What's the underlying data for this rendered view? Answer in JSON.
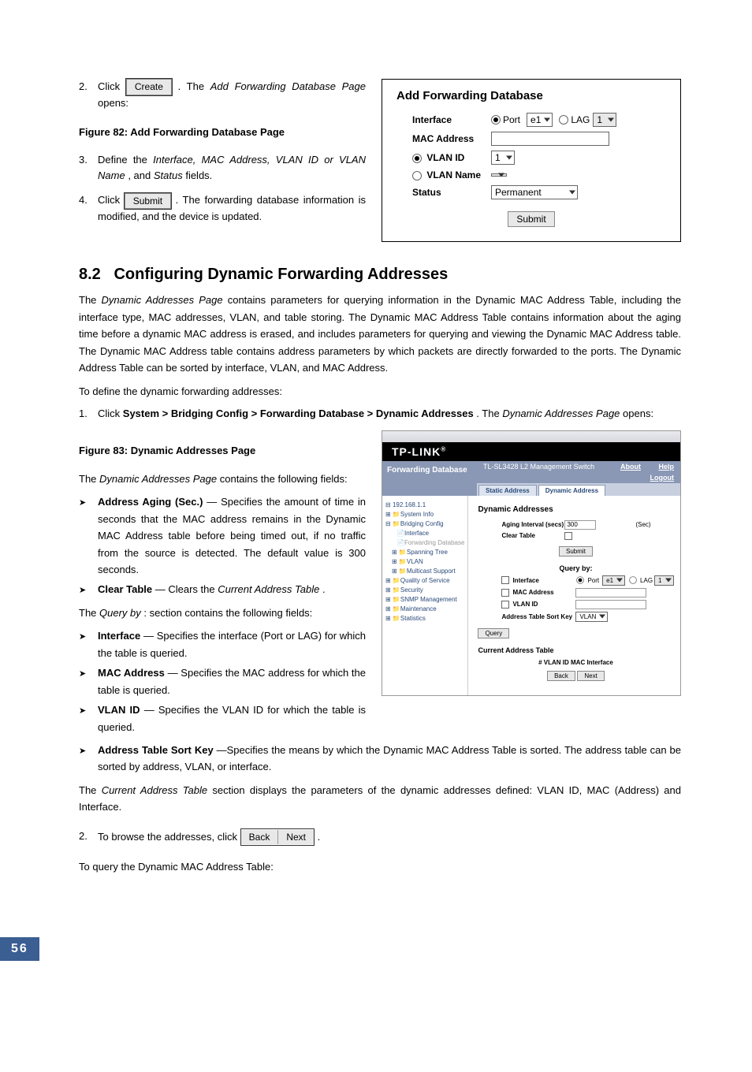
{
  "steps_top": {
    "s2_num": "2.",
    "s2_a": "Click ",
    "s2_btn": "Create",
    "s2_b": ". The ",
    "s2_c": "Add Forwarding Database Page",
    "s2_d": " opens:",
    "s3_num": "3.",
    "s3_a": "Define the ",
    "s3_b": "Interface, MAC Address, VLAN ID or VLAN Name",
    "s3_c": ", and ",
    "s3_d": "Status",
    "s3_e": " fields.",
    "s4_num": "4.",
    "s4_a": "Click ",
    "s4_btn": "Submit",
    "s4_b": ". The forwarding database information is modified, and the device is updated."
  },
  "fig82_caption": "Figure 82: Add Forwarding Database Page",
  "afd": {
    "title": "Add Forwarding Database",
    "interface": "Interface",
    "port": "Port",
    "port_val": "e1",
    "lag": "LAG",
    "lag_val": "1",
    "mac": "MAC Address",
    "vlanid": "VLAN ID",
    "vlanid_val": "1",
    "vlanname": "VLAN Name",
    "status": "Status",
    "status_val": "Permanent",
    "submit": "Submit"
  },
  "section_num": "8.2",
  "section_title": "Configuring Dynamic Forwarding Addresses",
  "para1_a": "The ",
  "para1_b": "Dynamic Addresses Page",
  "para1_c": " contains parameters for querying information in the Dynamic MAC Address Table, including the interface type, MAC addresses, VLAN, and table storing. The Dynamic MAC Address Table contains information about the aging time before a dynamic MAC address is erased, and includes parameters for querying and viewing the Dynamic MAC Address table. The Dynamic MAC Address table contains address parameters by which packets are directly forwarded to the ports. The Dynamic Address Table can be sorted by interface, VLAN, and MAC Address.",
  "para2": "To define the dynamic forwarding addresses:",
  "step1_num": "1.",
  "step1_a": "Click ",
  "step1_b": "System > Bridging Config > Forwarding Database > Dynamic Addresses",
  "step1_c": ". The ",
  "step1_d": "Dynamic Addresses Page",
  "step1_e": " opens:",
  "fig83_caption": "Figure 83: Dynamic Addresses Page",
  "para3_a": "The ",
  "para3_b": "Dynamic Addresses Page",
  "para3_c": " contains the following fields:",
  "bullets1": {
    "b1_a": "Address Aging (Sec.)",
    "b1_b": " — Specifies the amount of time in seconds that the MAC address remains in the Dynamic MAC Address table before being timed out, if no traffic from the source is detected. The default value is 300 seconds.",
    "b2_a": "Clear Table",
    "b2_b": " — Clears the ",
    "b2_c": "Current Address Table",
    "b2_d": "."
  },
  "para4_a": "The ",
  "para4_b": "Query by",
  "para4_c": ": section contains the following fields:",
  "bullets2": {
    "b1_a": "Interface",
    "b1_b": " — Specifies the interface (Port or LAG) for which the table is queried.",
    "b2_a": "MAC Address",
    "b2_b": " — Specifies the MAC address for which the table is queried.",
    "b3_a": "VLAN ID",
    "b3_b": " — Specifies the VLAN ID for which the table is queried.",
    "b4_a": "Address Table Sort Key",
    "b4_b": " —Specifies the means by which the Dynamic MAC Address Table is sorted. The address table can be sorted by address, VLAN, or interface."
  },
  "para5_a": "The ",
  "para5_b": "Current Address Table",
  "para5_c": " section displays the parameters of the dynamic addresses defined: VLAN ID, MAC (Address) and Interface.",
  "step2_num": "2.",
  "step2_a": "To browse the addresses, click ",
  "step2_back": "Back",
  "step2_next": "Next",
  "step2_b": ".",
  "para6": "To query the Dynamic MAC Address Table:",
  "fig83": {
    "brand": "TP-LINK",
    "header_left": "Forwarding Database",
    "header_model": "TL-SL3428 L2 Management Switch",
    "header_about": "About",
    "header_help": "Help",
    "header_logout": "Logout",
    "tab1": "Static Address",
    "tab2": "Dynamic Address",
    "tree": {
      "ip": "192.168.1.1",
      "i1": "System Info",
      "i2": "Bridging Config",
      "i2a": "Interface",
      "i2b": "Forwarding Database",
      "i2c": "Spanning Tree",
      "i2d": "VLAN",
      "i2e": "Multicast Support",
      "i3": "Quality of Service",
      "i4": "Security",
      "i5": "SNMP Management",
      "i6": "Maintenance",
      "i7": "Statistics"
    },
    "main": {
      "title": "Dynamic Addresses",
      "aging": "Aging Interval (secs)",
      "aging_val": "300",
      "aging_unit": "(Sec)",
      "clear": "Clear Table",
      "submit": "Submit",
      "queryby": "Query by:",
      "interface": "Interface",
      "port": "Port",
      "port_val": "e1",
      "lag": "LAG",
      "lag_val": "1",
      "mac": "MAC Address",
      "vlanid": "VLAN ID",
      "sortkey": "Address Table Sort Key",
      "sortkey_val": "VLAN",
      "query": "Query",
      "cat": "Current Address Table",
      "cat_cols": "# VLAN ID MAC Interface",
      "back": "Back",
      "next": "Next"
    }
  },
  "page_number": "56"
}
